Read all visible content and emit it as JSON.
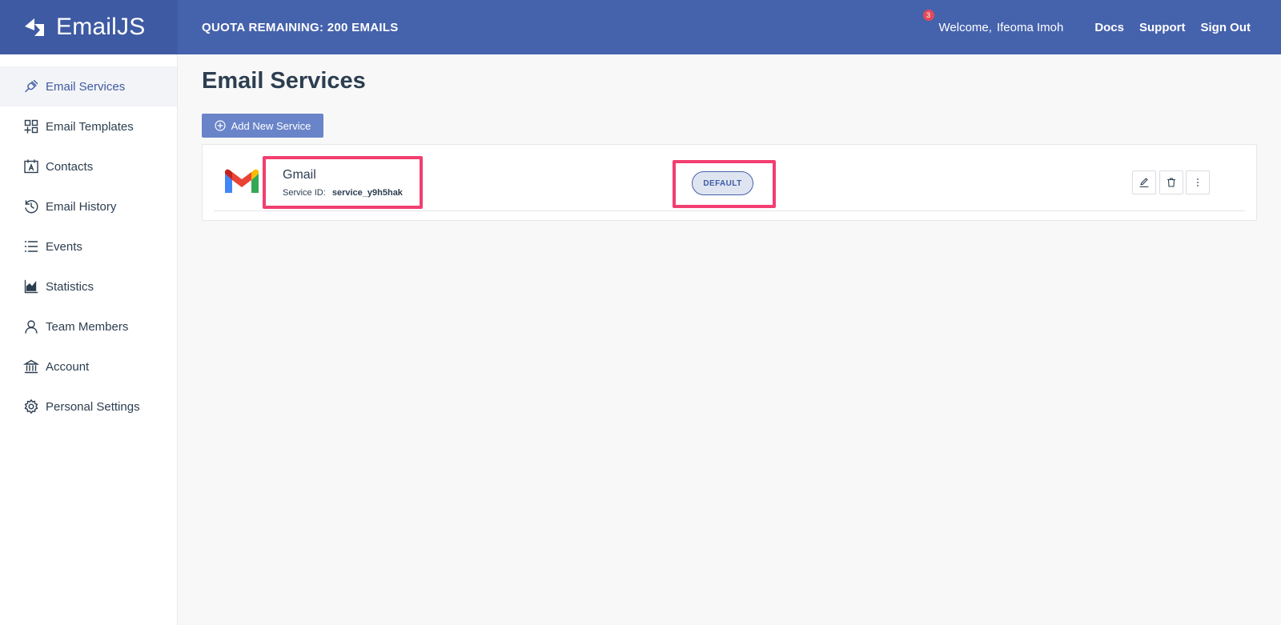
{
  "header": {
    "brand": "EmailJS",
    "quota": "QUOTA REMAINING: 200 EMAILS",
    "notification_count": "3",
    "welcome_label": "Welcome,",
    "user_name": "Ifeoma Imoh",
    "docs": "Docs",
    "support": "Support",
    "sign_out": "Sign Out"
  },
  "sidebar": {
    "items": [
      {
        "label": "Email Services",
        "icon": "plug-icon",
        "active": true
      },
      {
        "label": "Email Templates",
        "icon": "templates-icon"
      },
      {
        "label": "Contacts",
        "icon": "contacts-icon"
      },
      {
        "label": "Email History",
        "icon": "history-icon"
      },
      {
        "label": "Events",
        "icon": "list-icon"
      },
      {
        "label": "Statistics",
        "icon": "chart-icon"
      },
      {
        "label": "Team Members",
        "icon": "user-icon"
      },
      {
        "label": "Account",
        "icon": "bank-icon"
      },
      {
        "label": "Personal Settings",
        "icon": "gear-icon"
      }
    ]
  },
  "main": {
    "title": "Email Services",
    "add_button": "Add New Service",
    "services": [
      {
        "name": "Gmail",
        "service_id_label": "Service ID:",
        "service_id": "service_y9h5hak",
        "badge": "DEFAULT"
      }
    ]
  },
  "colors": {
    "header_bg": "#4562ac",
    "brand_bg": "#3e5aa3",
    "accent": "#3e5aa3",
    "highlight": "#f23e70",
    "button_bg": "#6a84c9"
  }
}
